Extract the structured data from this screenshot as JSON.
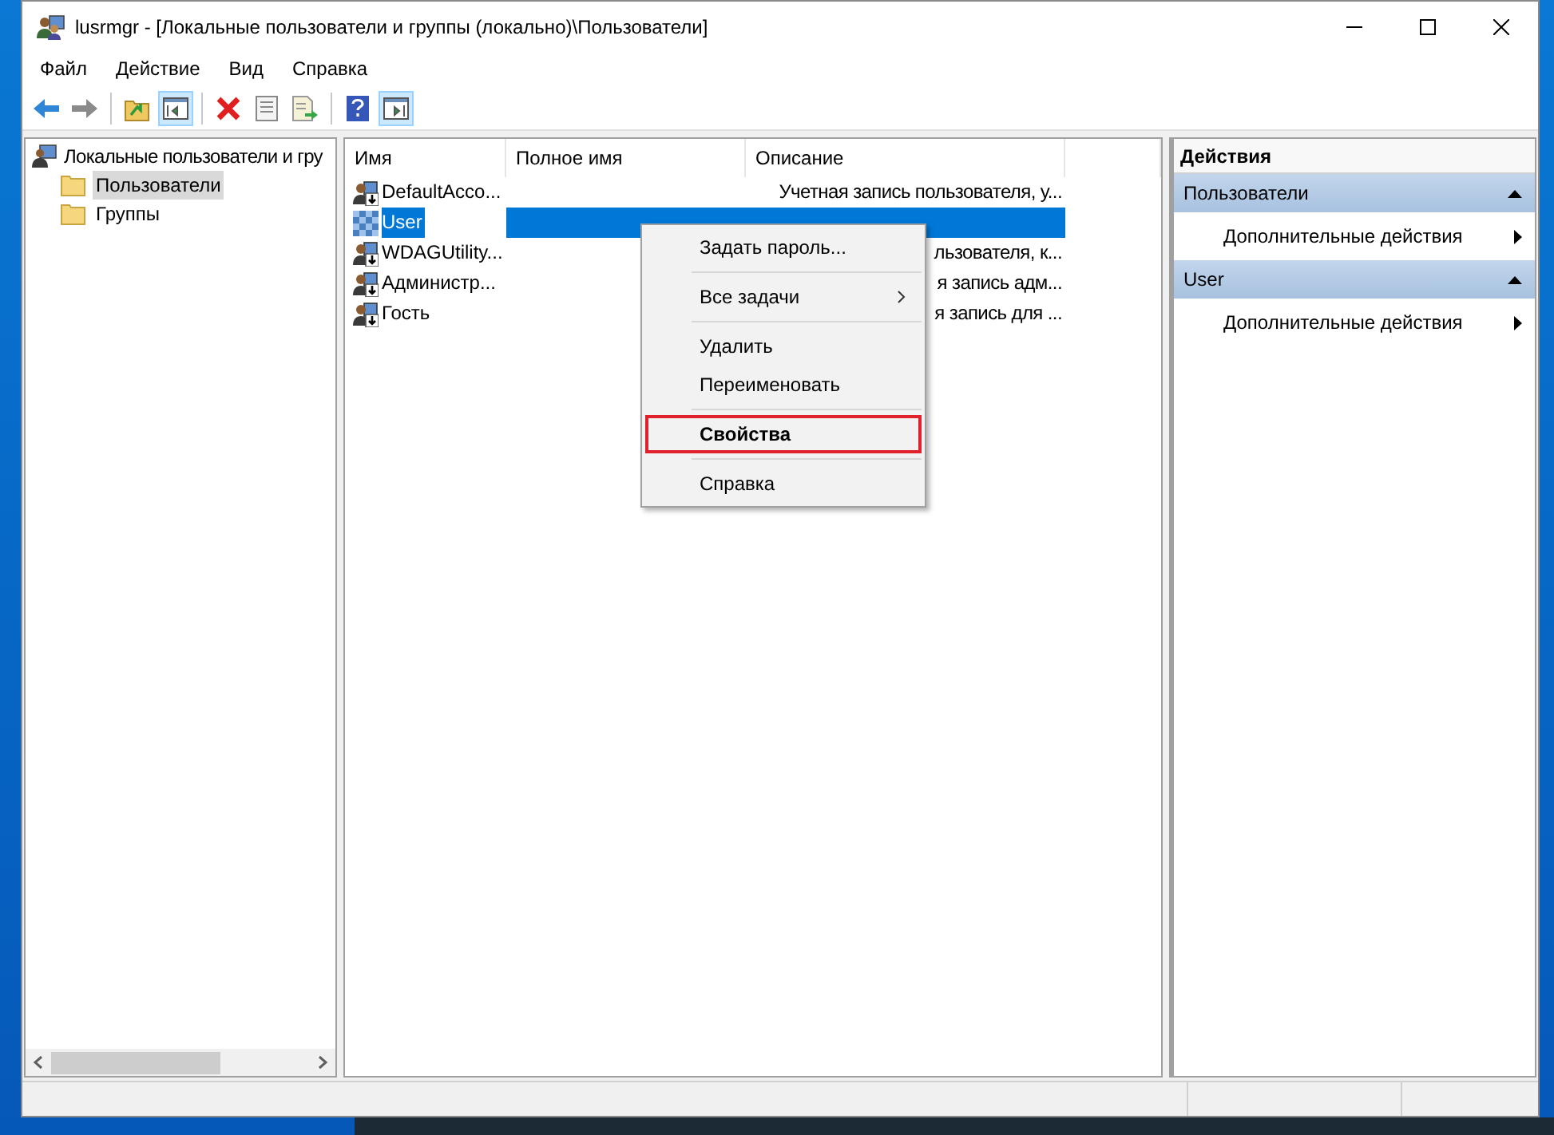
{
  "window": {
    "title": "lusrmgr - [Локальные пользователи и группы (локально)\\Пользователи]"
  },
  "menu_bar": [
    "Файл",
    "Действие",
    "Вид",
    "Справка"
  ],
  "toolbar": [
    {
      "kind": "back",
      "pressed": false
    },
    {
      "kind": "forward",
      "pressed": false
    },
    {
      "kind": "separator"
    },
    {
      "kind": "up",
      "pressed": false
    },
    {
      "kind": "tree",
      "pressed": true
    },
    {
      "kind": "separator"
    },
    {
      "kind": "delete",
      "pressed": false
    },
    {
      "kind": "properties",
      "pressed": false
    },
    {
      "kind": "export",
      "pressed": false
    },
    {
      "kind": "separator"
    },
    {
      "kind": "help",
      "pressed": false
    },
    {
      "kind": "actionpane",
      "pressed": true
    }
  ],
  "tree": {
    "label": "Локальные пользователи и гру",
    "children": [
      {
        "label": "Пользователи",
        "selected": true
      },
      {
        "label": "Группы",
        "selected": false
      }
    ]
  },
  "table": {
    "columns": [
      "Имя",
      "Полное имя",
      "Описание"
    ],
    "rows": [
      {
        "name": "DefaultAcco...",
        "full_name": "",
        "description": "Учетная запись пользователя, у...",
        "selected": false,
        "kind": "normal"
      },
      {
        "name": "User",
        "full_name": "",
        "description": "",
        "selected": true,
        "kind": "checker"
      },
      {
        "name": "WDAGUtility...",
        "full_name": "",
        "description": "льзователя, к...",
        "selected": false,
        "kind": "normal"
      },
      {
        "name": "Администр...",
        "full_name": "",
        "description": "я запись адм...",
        "selected": false,
        "kind": "normal"
      },
      {
        "name": "Гость",
        "full_name": "",
        "description": "я запись для ...",
        "selected": false,
        "kind": "normal"
      }
    ]
  },
  "context_menu": [
    {
      "kind": "item",
      "label": "Задать пароль...",
      "highlighted": false
    },
    {
      "kind": "separator"
    },
    {
      "kind": "submenu",
      "label": "Все задачи",
      "highlighted": false
    },
    {
      "kind": "separator"
    },
    {
      "kind": "item",
      "label": "Удалить",
      "highlighted": false
    },
    {
      "kind": "item",
      "label": "Переименовать",
      "highlighted": false
    },
    {
      "kind": "separator"
    },
    {
      "kind": "item",
      "label": "Свойства",
      "highlighted": true
    },
    {
      "kind": "separator"
    },
    {
      "kind": "item",
      "label": "Справка",
      "highlighted": false
    }
  ],
  "actions": {
    "title": "Действия",
    "sections": [
      {
        "title": "Пользователи",
        "expanded": true,
        "items": [
          "Дополнительные действия"
        ]
      },
      {
        "title": "User",
        "expanded": true,
        "items": [
          "Дополнительные действия"
        ]
      }
    ]
  }
}
